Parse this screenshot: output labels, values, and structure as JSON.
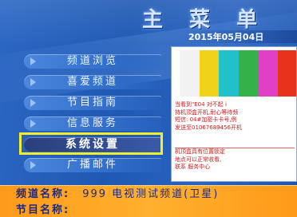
{
  "header": {
    "title": "主 菜 单",
    "date": "2015年05月04日"
  },
  "menu": {
    "items": [
      {
        "label": "频道浏览"
      },
      {
        "label": "喜爱频道"
      },
      {
        "label": "节目指南"
      },
      {
        "label": "信息服务"
      },
      {
        "label": "系统设置",
        "selected": true
      },
      {
        "label": "广播邮件"
      }
    ]
  },
  "preview": {
    "color_bars": [
      "#f2f2f2",
      "#f0d21a",
      "#22c0c8",
      "#35b14a",
      "#e040c8",
      "#e8321c"
    ],
    "message_lines": [
      "当看到\"E04 对不起 i",
      "持机顶盒开机,耐心等待频",
      "短信: 04#加密卡卡号,例",
      "发送至01067689456开机"
    ],
    "message_lines_2": [
      "机顶盒具有位置锁定",
      "地点可以正常收看,",
      "联系 服务中心"
    ]
  },
  "channel_info": {
    "channel_name_label": "频道名称:",
    "channel_name_value": "999 电视测试频道(卫星)",
    "program_name_label": "节目名称:",
    "program_name_value": ""
  }
}
